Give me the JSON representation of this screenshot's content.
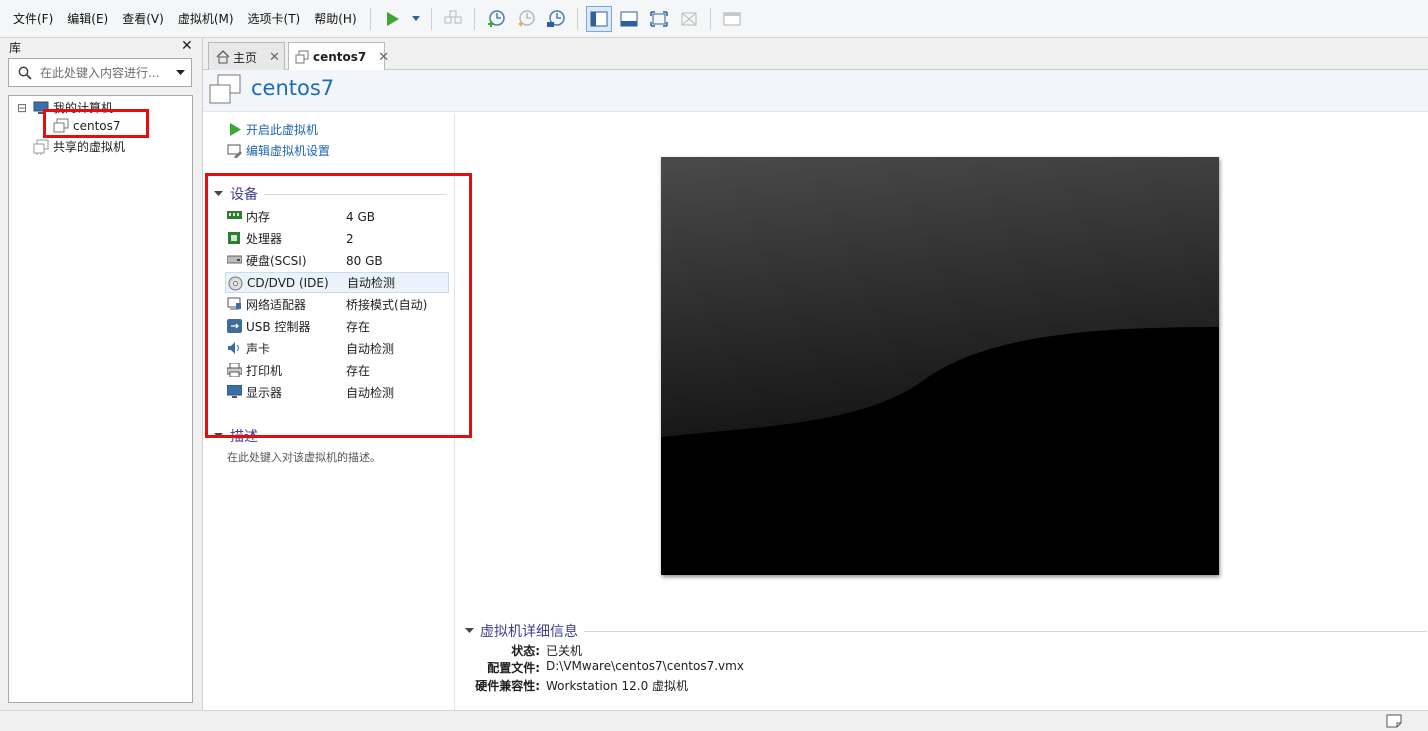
{
  "menu": [
    "文件(F)",
    "编辑(E)",
    "查看(V)",
    "虚拟机(M)",
    "选项卡(T)",
    "帮助(H)"
  ],
  "toolbar": {
    "icons": [
      "play-icon",
      "dropdown-arrow-icon",
      "send-keys-icon",
      "snapshot-icon",
      "revert-snapshot-icon",
      "snapshot-manager-icon",
      "library-view-icon",
      "thumbnail-bar-icon",
      "fullscreen-icon",
      "unity-icon",
      "console-view-icon"
    ]
  },
  "library": {
    "title": "库",
    "close": "✕",
    "search_placeholder": "在此处键入内容进行...",
    "tree": {
      "my_computer": "我的计算机",
      "vm": "centos7",
      "shared": "共享的虚拟机",
      "expand_symbol": "⊟"
    }
  },
  "tabs": [
    {
      "label": "主页",
      "close": "✕"
    },
    {
      "label": "centos7",
      "close": "✕"
    }
  ],
  "vm": {
    "title": "centos7",
    "actions": {
      "power_on": "开启此虚拟机",
      "edit_settings": "编辑虚拟机设置"
    },
    "devices_title": "设备",
    "devices": [
      {
        "name": "内存",
        "value": "4 GB",
        "icon": "memory-icon"
      },
      {
        "name": "处理器",
        "value": "2",
        "icon": "cpu-icon"
      },
      {
        "name": "硬盘(SCSI)",
        "value": "80 GB",
        "icon": "hard-disk-icon"
      },
      {
        "name": "CD/DVD (IDE)",
        "value": "自动检测",
        "icon": "cd-dvd-icon"
      },
      {
        "name": "网络适配器",
        "value": "桥接模式(自动)",
        "icon": "network-adapter-icon"
      },
      {
        "name": "USB 控制器",
        "value": "存在",
        "icon": "usb-icon"
      },
      {
        "name": "声卡",
        "value": "自动检测",
        "icon": "sound-card-icon"
      },
      {
        "name": "打印机",
        "value": "存在",
        "icon": "printer-icon"
      },
      {
        "name": "显示器",
        "value": "自动检测",
        "icon": "display-icon"
      }
    ],
    "description_title": "描述",
    "description_placeholder": "在此处键入对该虚拟机的描述。",
    "details_title": "虚拟机详细信息",
    "details": [
      {
        "label": "状态:",
        "value": "已关机"
      },
      {
        "label": "配置文件:",
        "value": "D:\\VMware\\centos7\\centos7.vmx"
      },
      {
        "label": "硬件兼容性:",
        "value": "Workstation 12.0 虚拟机"
      }
    ]
  },
  "colors": {
    "accent": "#1e6bb4",
    "section": "#3f3f90",
    "highlight": "#e01010",
    "play": "#3aa735"
  }
}
